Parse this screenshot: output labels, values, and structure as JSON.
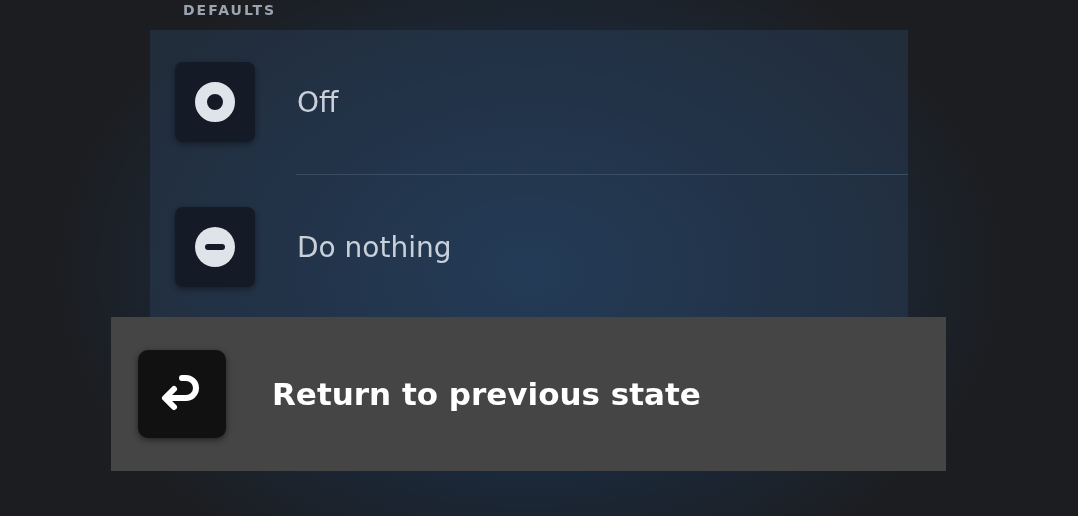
{
  "section_header": "DEFAULTS",
  "options": [
    {
      "kind": "ring",
      "label": "Off"
    },
    {
      "kind": "minus",
      "label": "Do nothing"
    }
  ],
  "dragged_option": {
    "kind": "return",
    "label": "Return to previous state"
  }
}
